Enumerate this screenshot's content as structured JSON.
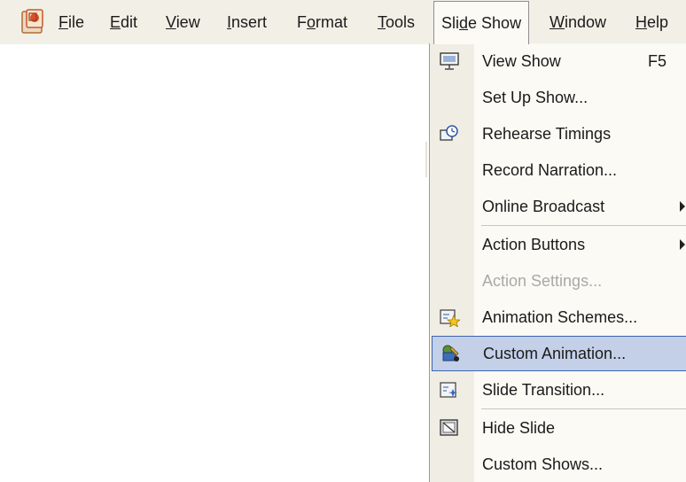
{
  "menubar": {
    "items": [
      {
        "label": "File",
        "u": "F"
      },
      {
        "label": "Edit",
        "u": "E"
      },
      {
        "label": "View",
        "u": "V"
      },
      {
        "label": "Insert",
        "u": "I"
      },
      {
        "label": "Format",
        "u": "o"
      },
      {
        "label": "Tools",
        "u": "T"
      },
      {
        "label": "Slide Show",
        "u": "d"
      },
      {
        "label": "Window",
        "u": "W"
      },
      {
        "label": "Help",
        "u": "H"
      }
    ],
    "open_menu": "Slide Show"
  },
  "menu": {
    "items": [
      {
        "label": "View Show",
        "shortcut": "F5",
        "icon": "view-show-icon"
      },
      {
        "label": "Set Up Show..."
      },
      {
        "label": "Rehearse Timings",
        "icon": "rehearse-timings-icon"
      },
      {
        "label": "Record Narration..."
      },
      {
        "label": "Online Broadcast",
        "submenu": true
      },
      {
        "label": "Action Buttons",
        "submenu": true
      },
      {
        "label": "Action Settings...",
        "disabled": true
      },
      {
        "label": "Animation Schemes...",
        "icon": "animation-schemes-icon"
      },
      {
        "label": "Custom Animation...",
        "icon": "custom-animation-icon",
        "highlighted": true
      },
      {
        "label": "Slide Transition...",
        "icon": "slide-transition-icon"
      },
      {
        "label": "Hide Slide",
        "icon": "hide-slide-icon"
      },
      {
        "label": "Custom Shows..."
      }
    ]
  },
  "colors": {
    "menubar_bg": "#f2f0e6",
    "menu_bg": "#fbfaf4",
    "gutter_bg": "#f0eee4",
    "highlight_bg": "#c4d0e8",
    "highlight_border": "#3d65b0",
    "disabled_text": "#a9a9a9"
  }
}
